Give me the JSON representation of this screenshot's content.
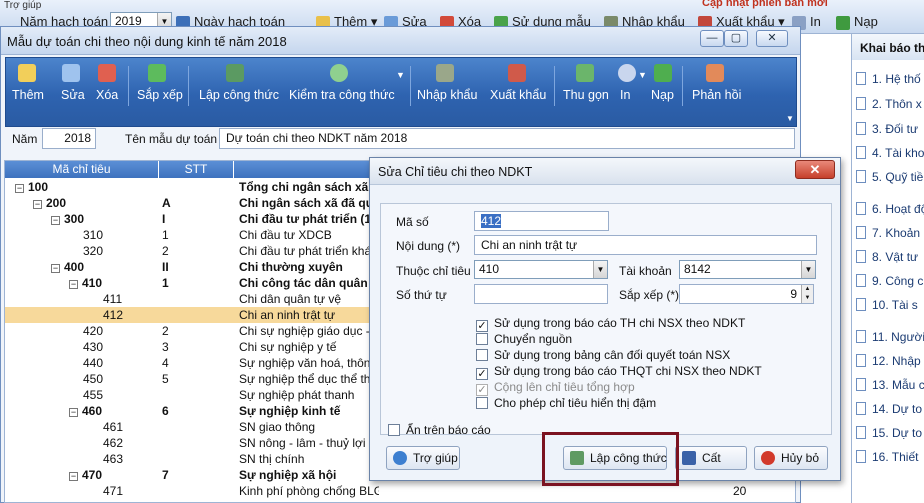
{
  "appbar": {
    "year_label": "Năm hạch toán",
    "year_value": "2019",
    "date_label": "Ngày hạch toán",
    "buttons": [
      "Thêm",
      "Sửa",
      "Xóa",
      "Sử dụng mẫu",
      "Nhập khẩu",
      "Xuất khẩu",
      "In",
      "Nạp"
    ],
    "menu_hint": "Trợ giúp",
    "promo": "Cập nhật phiên bản mới"
  },
  "right_panel": {
    "title": "Khai báo thố",
    "items": [
      "1. Hệ thố",
      "2. Thôn x",
      "3. Đối tư",
      "4. Tài kho",
      "5. Quỹ tiề",
      "6. Hoạt độ",
      "7. Khoản",
      "8. Vật tư",
      "9. Công c",
      "10. Tài s",
      "11. Người",
      "12. Nhập",
      "13. Mẫu c",
      "14. Dự to",
      "15. Dự to",
      "16. Thiết"
    ]
  },
  "main_window": {
    "title": "Mẫu dự toán chi theo nội dung kinh tế năm 2018",
    "toolbar": [
      "Thêm",
      "Sửa",
      "Xóa",
      "Sắp xếp",
      "Lập công thức",
      "Kiểm tra công thức",
      "Nhập khẩu",
      "Xuất khẩu",
      "Thu gọn",
      "In",
      "Nạp",
      "Phản hồi"
    ],
    "year_label": "Năm",
    "year_value": "2018",
    "template_label": "Tên mẫu dự toán",
    "template_value": "Dự toán chi theo NDKT năm 2018"
  },
  "grid": {
    "columns": [
      "Mã chỉ tiêu",
      "STT"
    ],
    "rows": [
      {
        "code": "100",
        "stt": "",
        "name": "Tổng chi ngân sách xã",
        "bold": true,
        "expander": "−",
        "indent": 0,
        "val": ""
      },
      {
        "code": "200",
        "stt": "A",
        "name": "Chi ngân sách xã đã qua",
        "bold": true,
        "expander": "−",
        "indent": 1,
        "val": ""
      },
      {
        "code": "300",
        "stt": "I",
        "name": "Chi đầu tư phát triển (1)",
        "bold": true,
        "expander": "−",
        "indent": 2,
        "val": ""
      },
      {
        "code": "310",
        "stt": "1",
        "name": "Chi đầu tư XDCB",
        "bold": false,
        "expander": "",
        "indent": 3,
        "val": ""
      },
      {
        "code": "320",
        "stt": "2",
        "name": "Chi đầu tư phát triển khác",
        "bold": false,
        "expander": "",
        "indent": 3,
        "val": ""
      },
      {
        "code": "400",
        "stt": "II",
        "name": "Chi thường xuyên",
        "bold": true,
        "expander": "−",
        "indent": 2,
        "val": ""
      },
      {
        "code": "410",
        "stt": "1",
        "name": "Chi công tác dân quân tự",
        "bold": true,
        "expander": "−",
        "indent": 3,
        "val": ""
      },
      {
        "code": "411",
        "stt": "",
        "name": "Chi dân quân tự vệ",
        "bold": false,
        "expander": "",
        "indent": 4,
        "val": ""
      },
      {
        "code": "412",
        "stt": "",
        "name": "Chi an ninh trật tự",
        "bold": false,
        "expander": "",
        "indent": 4,
        "val": "",
        "selected": true
      },
      {
        "code": "420",
        "stt": "2",
        "name": "Chi sự nghiệp giáo dục - đ",
        "bold": false,
        "expander": "",
        "indent": 3,
        "val": ""
      },
      {
        "code": "430",
        "stt": "3",
        "name": "Chi sự nghiệp y tế",
        "bold": false,
        "expander": "",
        "indent": 3,
        "val": ""
      },
      {
        "code": "440",
        "stt": "4",
        "name": "Sự nghiệp văn hoá, thông ti",
        "bold": false,
        "expander": "",
        "indent": 3,
        "val": ""
      },
      {
        "code": "450",
        "stt": "5",
        "name": "Sự nghiệp thể dục thể thao",
        "bold": false,
        "expander": "",
        "indent": 3,
        "val": ""
      },
      {
        "code": "455",
        "stt": "",
        "name": "Sự nghiệp phát thanh",
        "bold": false,
        "expander": "",
        "indent": 3,
        "val": ""
      },
      {
        "code": "460",
        "stt": "6",
        "name": "Sự nghiệp kinh tế",
        "bold": true,
        "expander": "−",
        "indent": 3,
        "val": ""
      },
      {
        "code": "461",
        "stt": "",
        "name": "SN giao thông",
        "bold": false,
        "expander": "",
        "indent": 4,
        "val": ""
      },
      {
        "code": "462",
        "stt": "",
        "name": "SN nông - lâm - thuỷ lợi - h",
        "bold": false,
        "expander": "",
        "indent": 4,
        "val": ""
      },
      {
        "code": "463",
        "stt": "",
        "name": "SN thị chính",
        "bold": false,
        "expander": "",
        "indent": 4,
        "val": ""
      },
      {
        "code": "470",
        "stt": "7",
        "name": "Sự nghiệp xã hội",
        "bold": true,
        "expander": "−",
        "indent": 3,
        "val": ""
      },
      {
        "code": "471",
        "stt": "",
        "name": "Kinh phí phòng chống BLGĐ",
        "bold": false,
        "expander": "",
        "indent": 4,
        "val": "20"
      }
    ]
  },
  "dialog": {
    "title": "Sửa Chỉ tiêu chi theo NDKT",
    "ma_so_label": "Mã số",
    "ma_so_value": "412",
    "noi_dung_label": "Nội dung (*)",
    "noi_dung_value": "Chi an ninh trật tự",
    "thuoc_label": "Thuộc chỉ tiêu",
    "thuoc_value": "410",
    "tai_khoan_label": "Tài khoản",
    "tai_khoan_value": "8142",
    "so_thu_tu_label": "Số thứ tự",
    "so_thu_tu_value": "",
    "sap_xep_label": "Sắp xếp (*)",
    "sap_xep_value": "9",
    "checkboxes": [
      {
        "label": "Sử dụng trong báo cáo TH chi NSX theo NDKT",
        "checked": true,
        "disabled": false
      },
      {
        "label": "Chuyển nguồn",
        "checked": false,
        "disabled": false
      },
      {
        "label": "Sử dụng trong bảng cân đối quyết toán NSX",
        "checked": false,
        "disabled": false
      },
      {
        "label": "Sử dụng trong báo cáo THQT chi NSX theo NDKT",
        "checked": true,
        "disabled": false
      },
      {
        "label": "Cộng lên chỉ tiêu tổng hợp",
        "checked": true,
        "disabled": true
      },
      {
        "label": "Cho phép chỉ tiêu hiển thị đậm",
        "checked": false,
        "disabled": false
      }
    ],
    "an_tren_label": "Ẩn trên báo cáo",
    "help_button": "Trợ giúp",
    "formula_button": "Lập công thức",
    "save_button": "Cất",
    "cancel_button": "Hủy bỏ"
  }
}
